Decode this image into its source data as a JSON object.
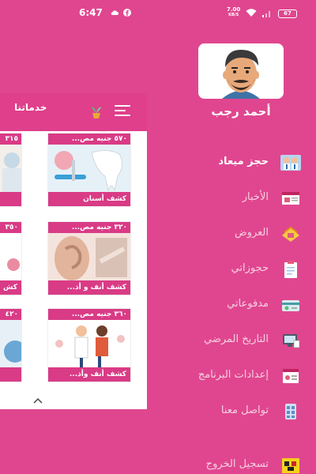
{
  "status_bar": {
    "time": "6:47",
    "net_speed_value": "7.00",
    "net_speed_unit": "KB/S",
    "battery": "67"
  },
  "drawer": {
    "profile_name": "أحمد رجب",
    "items": [
      {
        "label": "حجز ميعاد",
        "icon": "doctors-icon"
      },
      {
        "label": "الأخبار",
        "icon": "news-icon"
      },
      {
        "label": "العروض",
        "icon": "offers-icon"
      },
      {
        "label": "حجوزاتي",
        "icon": "clipboard-icon"
      },
      {
        "label": "مدفوعاتي",
        "icon": "payments-icon"
      },
      {
        "label": "التاريخ المرضي",
        "icon": "medical-history-icon"
      },
      {
        "label": "إعدادات البرنامج",
        "icon": "settings-icon"
      },
      {
        "label": "تواصل معنا",
        "icon": "contact-icon"
      },
      {
        "label": "تسجيل الخروج",
        "icon": "logout-icon"
      }
    ]
  },
  "main": {
    "title": "خدماتنا",
    "services": [
      {
        "price": "٥٧٠ جنيه مص...",
        "name": "كشف أسنان"
      },
      {
        "price": "٣١٥",
        "name": ""
      },
      {
        "price": "٣٢٠ جنيه مص...",
        "name": "كشف أنف و أذ..."
      },
      {
        "price": "٣٥٠",
        "name": "كش"
      },
      {
        "price": "٣٦٠ جنيه مص...",
        "name": "كشف أنف وأذ..."
      },
      {
        "price": "٤٢٠",
        "name": ""
      }
    ]
  }
}
